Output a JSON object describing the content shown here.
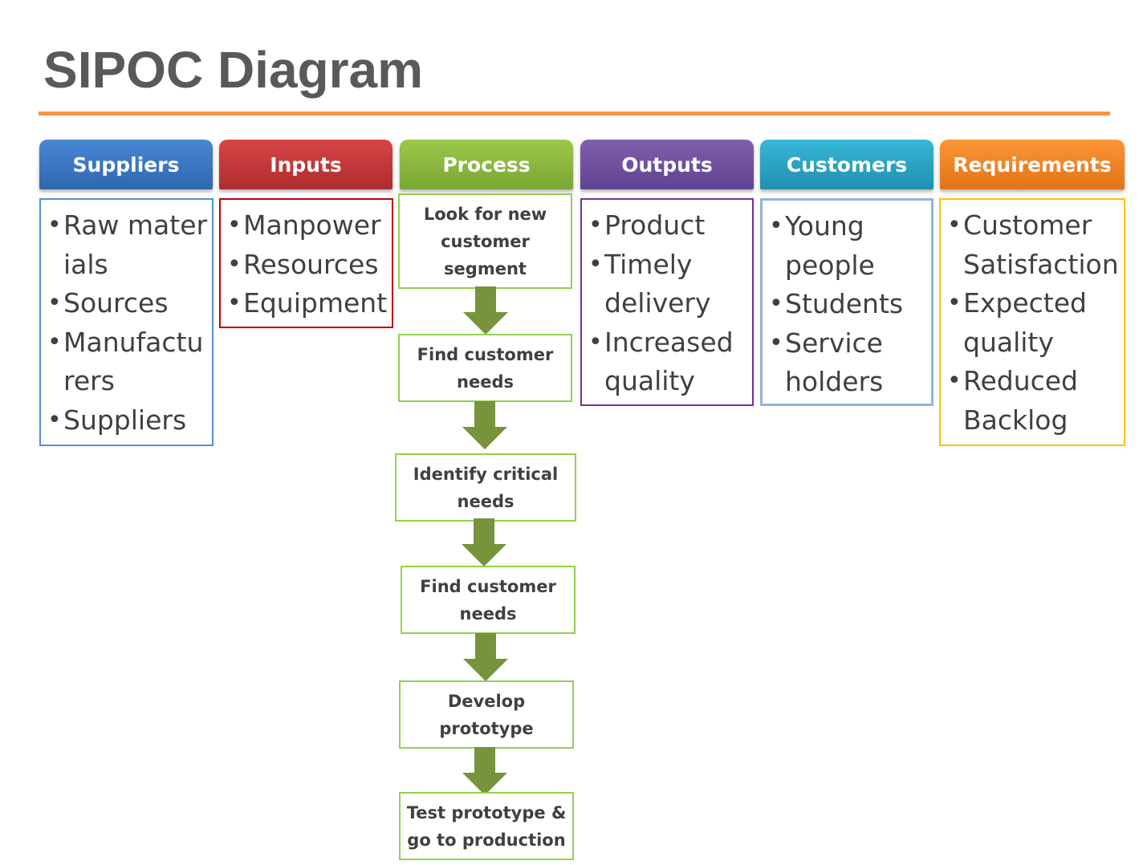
{
  "title": "SIPOC Diagram",
  "colors": {
    "accent_rule": "#f79646",
    "suppliers": "#3b78c6",
    "inputs": "#c9383a",
    "process": "#8dba3e",
    "outputs": "#7453a2",
    "customers": "#2fa8c9",
    "requirements": "#f68a26",
    "arrow": "#77933c"
  },
  "columns": [
    {
      "id": "suppliers",
      "header": "Suppliers",
      "items": [
        "Raw materials",
        "Sources",
        "Manufacturers",
        "Suppliers"
      ]
    },
    {
      "id": "inputs",
      "header": "Inputs",
      "items": [
        "Manpower",
        "Resources",
        "Equipment"
      ]
    },
    {
      "id": "process",
      "header": "Process"
    },
    {
      "id": "outputs",
      "header": "Outputs",
      "items": [
        "Product",
        "Timely delivery",
        "Increased quality"
      ]
    },
    {
      "id": "customers",
      "header": "Customers",
      "items": [
        "Young people",
        "Students",
        "Service holders"
      ]
    },
    {
      "id": "requirements",
      "header": "Requirements",
      "items": [
        "Customer Satisfaction",
        "Expected quality",
        "Reduced Backlog"
      ]
    }
  ],
  "process_steps": [
    "Look for new customer segment",
    "Find customer needs",
    "Identify critical needs",
    "Find customer needs",
    "Develop prototype",
    "Test prototype & go to production"
  ]
}
